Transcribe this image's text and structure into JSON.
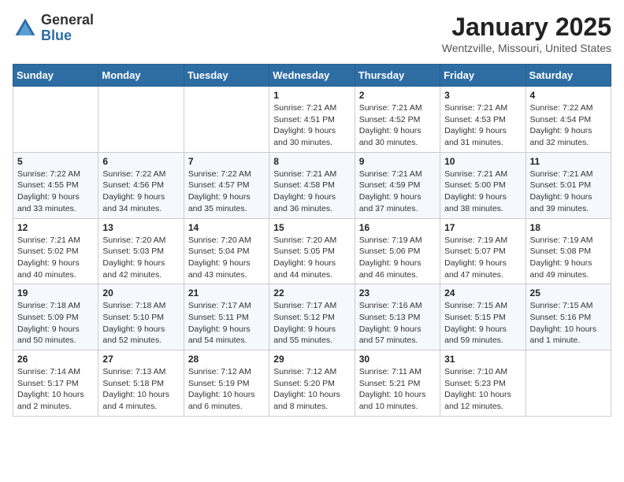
{
  "header": {
    "logo_general": "General",
    "logo_blue": "Blue",
    "title": "January 2025",
    "location": "Wentzville, Missouri, United States"
  },
  "weekdays": [
    "Sunday",
    "Monday",
    "Tuesday",
    "Wednesday",
    "Thursday",
    "Friday",
    "Saturday"
  ],
  "weeks": [
    [
      {
        "day": "",
        "info": ""
      },
      {
        "day": "",
        "info": ""
      },
      {
        "day": "",
        "info": ""
      },
      {
        "day": "1",
        "info": "Sunrise: 7:21 AM\nSunset: 4:51 PM\nDaylight: 9 hours\nand 30 minutes."
      },
      {
        "day": "2",
        "info": "Sunrise: 7:21 AM\nSunset: 4:52 PM\nDaylight: 9 hours\nand 30 minutes."
      },
      {
        "day": "3",
        "info": "Sunrise: 7:21 AM\nSunset: 4:53 PM\nDaylight: 9 hours\nand 31 minutes."
      },
      {
        "day": "4",
        "info": "Sunrise: 7:22 AM\nSunset: 4:54 PM\nDaylight: 9 hours\nand 32 minutes."
      }
    ],
    [
      {
        "day": "5",
        "info": "Sunrise: 7:22 AM\nSunset: 4:55 PM\nDaylight: 9 hours\nand 33 minutes."
      },
      {
        "day": "6",
        "info": "Sunrise: 7:22 AM\nSunset: 4:56 PM\nDaylight: 9 hours\nand 34 minutes."
      },
      {
        "day": "7",
        "info": "Sunrise: 7:22 AM\nSunset: 4:57 PM\nDaylight: 9 hours\nand 35 minutes."
      },
      {
        "day": "8",
        "info": "Sunrise: 7:21 AM\nSunset: 4:58 PM\nDaylight: 9 hours\nand 36 minutes."
      },
      {
        "day": "9",
        "info": "Sunrise: 7:21 AM\nSunset: 4:59 PM\nDaylight: 9 hours\nand 37 minutes."
      },
      {
        "day": "10",
        "info": "Sunrise: 7:21 AM\nSunset: 5:00 PM\nDaylight: 9 hours\nand 38 minutes."
      },
      {
        "day": "11",
        "info": "Sunrise: 7:21 AM\nSunset: 5:01 PM\nDaylight: 9 hours\nand 39 minutes."
      }
    ],
    [
      {
        "day": "12",
        "info": "Sunrise: 7:21 AM\nSunset: 5:02 PM\nDaylight: 9 hours\nand 40 minutes."
      },
      {
        "day": "13",
        "info": "Sunrise: 7:20 AM\nSunset: 5:03 PM\nDaylight: 9 hours\nand 42 minutes."
      },
      {
        "day": "14",
        "info": "Sunrise: 7:20 AM\nSunset: 5:04 PM\nDaylight: 9 hours\nand 43 minutes."
      },
      {
        "day": "15",
        "info": "Sunrise: 7:20 AM\nSunset: 5:05 PM\nDaylight: 9 hours\nand 44 minutes."
      },
      {
        "day": "16",
        "info": "Sunrise: 7:19 AM\nSunset: 5:06 PM\nDaylight: 9 hours\nand 46 minutes."
      },
      {
        "day": "17",
        "info": "Sunrise: 7:19 AM\nSunset: 5:07 PM\nDaylight: 9 hours\nand 47 minutes."
      },
      {
        "day": "18",
        "info": "Sunrise: 7:19 AM\nSunset: 5:08 PM\nDaylight: 9 hours\nand 49 minutes."
      }
    ],
    [
      {
        "day": "19",
        "info": "Sunrise: 7:18 AM\nSunset: 5:09 PM\nDaylight: 9 hours\nand 50 minutes."
      },
      {
        "day": "20",
        "info": "Sunrise: 7:18 AM\nSunset: 5:10 PM\nDaylight: 9 hours\nand 52 minutes."
      },
      {
        "day": "21",
        "info": "Sunrise: 7:17 AM\nSunset: 5:11 PM\nDaylight: 9 hours\nand 54 minutes."
      },
      {
        "day": "22",
        "info": "Sunrise: 7:17 AM\nSunset: 5:12 PM\nDaylight: 9 hours\nand 55 minutes."
      },
      {
        "day": "23",
        "info": "Sunrise: 7:16 AM\nSunset: 5:13 PM\nDaylight: 9 hours\nand 57 minutes."
      },
      {
        "day": "24",
        "info": "Sunrise: 7:15 AM\nSunset: 5:15 PM\nDaylight: 9 hours\nand 59 minutes."
      },
      {
        "day": "25",
        "info": "Sunrise: 7:15 AM\nSunset: 5:16 PM\nDaylight: 10 hours\nand 1 minute."
      }
    ],
    [
      {
        "day": "26",
        "info": "Sunrise: 7:14 AM\nSunset: 5:17 PM\nDaylight: 10 hours\nand 2 minutes."
      },
      {
        "day": "27",
        "info": "Sunrise: 7:13 AM\nSunset: 5:18 PM\nDaylight: 10 hours\nand 4 minutes."
      },
      {
        "day": "28",
        "info": "Sunrise: 7:12 AM\nSunset: 5:19 PM\nDaylight: 10 hours\nand 6 minutes."
      },
      {
        "day": "29",
        "info": "Sunrise: 7:12 AM\nSunset: 5:20 PM\nDaylight: 10 hours\nand 8 minutes."
      },
      {
        "day": "30",
        "info": "Sunrise: 7:11 AM\nSunset: 5:21 PM\nDaylight: 10 hours\nand 10 minutes."
      },
      {
        "day": "31",
        "info": "Sunrise: 7:10 AM\nSunset: 5:23 PM\nDaylight: 10 hours\nand 12 minutes."
      },
      {
        "day": "",
        "info": ""
      }
    ]
  ]
}
